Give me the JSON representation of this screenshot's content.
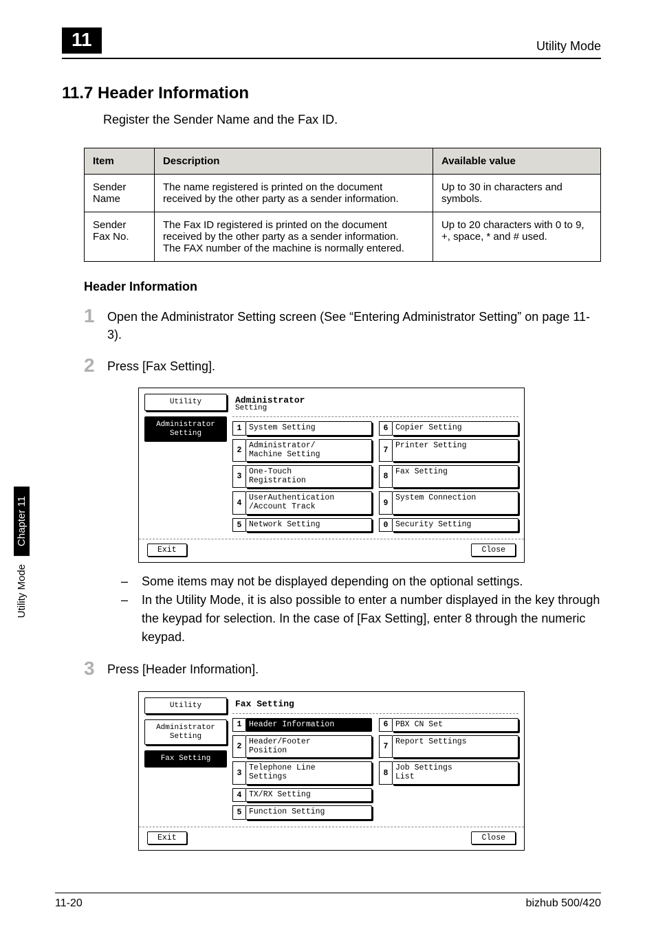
{
  "top": {
    "chapter_number": "11",
    "running_head": "Utility Mode"
  },
  "section": {
    "number_title": "11.7   Header Information",
    "intro": "Register the Sender Name and the Fax ID."
  },
  "table": {
    "headers": {
      "item": "Item",
      "description": "Description",
      "avail": "Available value"
    },
    "rows": [
      {
        "item": "Sender Name",
        "description": "The name registered is printed on the document received by the other party as a sender information.",
        "avail": "Up to 30 in characters and symbols."
      },
      {
        "item": "Sender Fax No.",
        "description": "The Fax ID registered is printed on the document received by the other party as a sender information.\nThe FAX number of the machine is normally entered.",
        "avail": "Up to 20 characters with 0 to 9, +, space, * and # used."
      }
    ]
  },
  "subheading": "Header Information",
  "steps": {
    "s1": "Open the Administrator Setting screen (See “Entering Administrator Setting” on page 11-3).",
    "s2": "Press [Fax Setting].",
    "s3": "Press [Header Information]."
  },
  "bullets": {
    "b1": "Some items may not be displayed depending on the optional settings.",
    "b2": "In the Utility Mode, it is also possible to enter a number displayed in the key through the keypad for selection. In the case of [Fax Setting], enter 8 through the numeric keypad."
  },
  "panel1": {
    "left_utility": "Utility",
    "left_admin": "Administrator\nSetting",
    "title": "Administrator",
    "subtitle": "Setting",
    "items": {
      "n1": "System Setting",
      "n2": "Administrator/\nMachine Setting",
      "n3": "One-Touch\nRegistration",
      "n4": "UserAuthentication\n/Account Track",
      "n5": "Network Setting",
      "n6": "Copier Setting",
      "n7": "Printer Setting",
      "n8": "Fax Setting",
      "n9": "System Connection",
      "n0": "Security Setting"
    },
    "exit": "Exit",
    "close": "Close"
  },
  "panel2": {
    "left_utility": "Utility",
    "left_admin": "Administrator\nSetting",
    "left_fax": "Fax Setting",
    "title": "Fax Setting",
    "items": {
      "n1": "Header Information",
      "n2": "Header/Footer\nPosition",
      "n3": "Telephone Line\nSettings",
      "n4": "TX/RX Setting",
      "n5": "Function Setting",
      "n6": "PBX CN Set",
      "n7": "Report Settings",
      "n8": "Job Settings\nList"
    },
    "exit": "Exit",
    "close": "Close"
  },
  "sidetab": {
    "black": "Chapter 11",
    "white": "Utility Mode"
  },
  "footer": {
    "left": "11-20",
    "right": "bizhub 500/420"
  }
}
